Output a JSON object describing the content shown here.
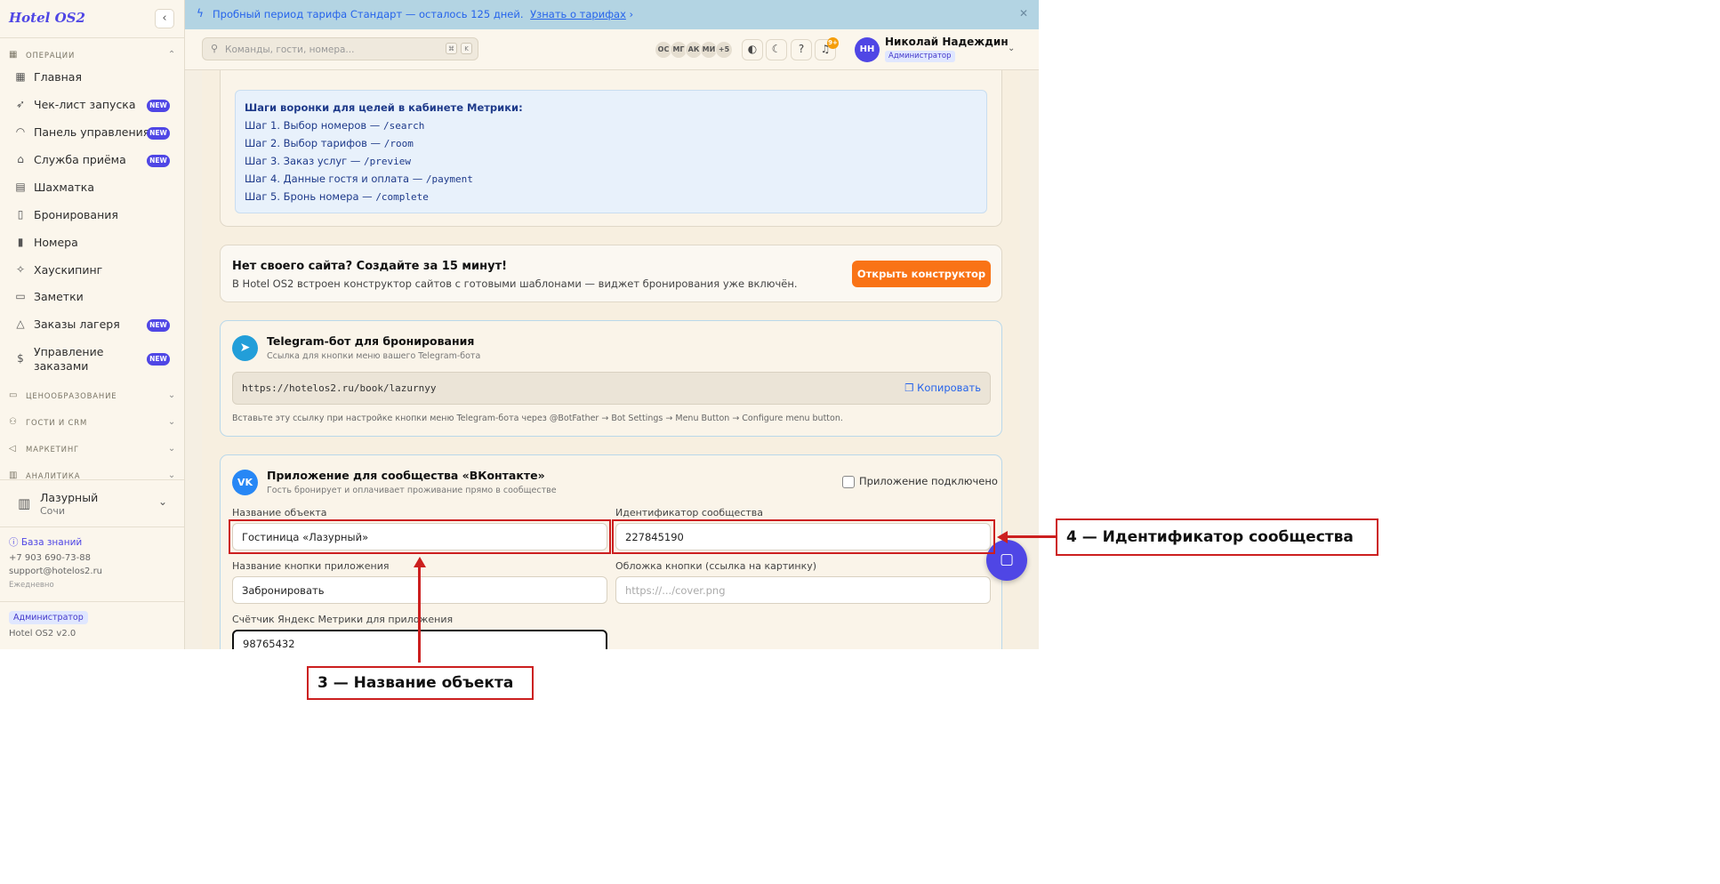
{
  "sidebar": {
    "logo": "Hotel OS2",
    "collapse_icon": "chevron-left-icon",
    "sections": {
      "operations": "ОПЕРАЦИИ",
      "pricing": "ЦЕНООБРАЗОВАНИЕ",
      "guests": "ГОСТИ И CRM",
      "marketing": "МАРКЕТИНГ",
      "analytics": "АНАЛИТИКА"
    },
    "items": [
      {
        "label": "Главная",
        "icon": "grid-icon",
        "badge": ""
      },
      {
        "label": "Чек-лист запуска",
        "icon": "rocket-icon",
        "badge": "NEW"
      },
      {
        "label": "Панель управления",
        "icon": "gauge-icon",
        "badge": "NEW"
      },
      {
        "label": "Служба приёма",
        "icon": "bell-icon",
        "badge": "NEW"
      },
      {
        "label": "Шахматка",
        "icon": "table-icon",
        "badge": ""
      },
      {
        "label": "Бронирования",
        "icon": "clipboard-icon",
        "badge": ""
      },
      {
        "label": "Номера",
        "icon": "door-icon",
        "badge": ""
      },
      {
        "label": "Хаускипинг",
        "icon": "sparkle-icon",
        "badge": ""
      },
      {
        "label": "Заметки",
        "icon": "note-icon",
        "badge": ""
      },
      {
        "label": "Заказы лагеря",
        "icon": "tent-icon",
        "badge": "NEW"
      },
      {
        "label": "Управление заказами",
        "icon": "dollar-icon",
        "badge": "NEW"
      }
    ],
    "property": {
      "name": "Лазурный",
      "city": "Сочи"
    },
    "help_link": "База знаний",
    "phone": "+7 903 690-73-88",
    "email": "support@hotelos2.ru",
    "schedule": "Ежедневно",
    "role_badge": "Администратор",
    "version": "Hotel OS2 v2.0"
  },
  "trial_banner": {
    "text": "Пробный период тарифа Стандарт — осталось 125 дней.",
    "link": "Узнать о тарифах"
  },
  "header": {
    "search_placeholder": "Команды, гости, номера...",
    "kbd1": "⌘",
    "kbd2": "K",
    "avatars": [
      "ОС",
      "МГ",
      "АК",
      "МИ",
      "+5"
    ],
    "notif_count": "9+",
    "user_initials": "НН",
    "user_name": "Николай Надеждин",
    "user_role": "Администратор"
  },
  "funnel": {
    "heading": "Шаги воронки для целей в кабинете Метрики:",
    "steps": [
      {
        "text": "Шаг 1. Выбор номеров — ",
        "path": "/search"
      },
      {
        "text": "Шаг 2. Выбор тарифов — ",
        "path": "/room"
      },
      {
        "text": "Шаг 3. Заказ услуг — ",
        "path": "/preview"
      },
      {
        "text": "Шаг 4. Данные гостя и оплата — ",
        "path": "/payment"
      },
      {
        "text": "Шаг 5. Бронь номера — ",
        "path": "/complete"
      }
    ]
  },
  "site_builder": {
    "title": "Нет своего сайта? Создайте за 15 минут!",
    "desc": "В Hotel OS2 встроен конструктор сайтов с готовыми шаблонами — виджет бронирования уже включён.",
    "button": "Открыть конструктор"
  },
  "telegram": {
    "title": "Telegram-бот для бронирования",
    "subtitle": "Ссылка для кнопки меню вашего Telegram-бота",
    "link": "https://hotelos2.ru/book/lazurnyy",
    "copy": "Копировать",
    "hint": "Вставьте эту ссылку при настройке кнопки меню Telegram-бота через @BotFather → Bot Settings → Menu Button → Configure menu button."
  },
  "vk": {
    "icon_text": "VK",
    "title": "Приложение для сообщества «ВКонтакте»",
    "subtitle": "Гость бронирует и оплачивает проживание прямо в сообществе",
    "connected_label": "Приложение подключено",
    "object_name_label": "Название объекта",
    "object_name": "Гостиница «Лазурный»",
    "community_id_label": "Идентификатор сообщества",
    "community_id": "227845190",
    "button_name_label": "Название кнопки приложения",
    "button_name": "Забронировать",
    "cover_label": "Обложка кнопки (ссылка на картинку)",
    "cover_placeholder": "https://.../cover.png",
    "metrika_label": "Счётчик Яндекс Метрики для приложения",
    "metrika": "98765432"
  },
  "annotations": {
    "callout3": "3 — Название объекта",
    "callout4": "4 — Идентификатор сообщества",
    "color": "#cc1f1f"
  }
}
